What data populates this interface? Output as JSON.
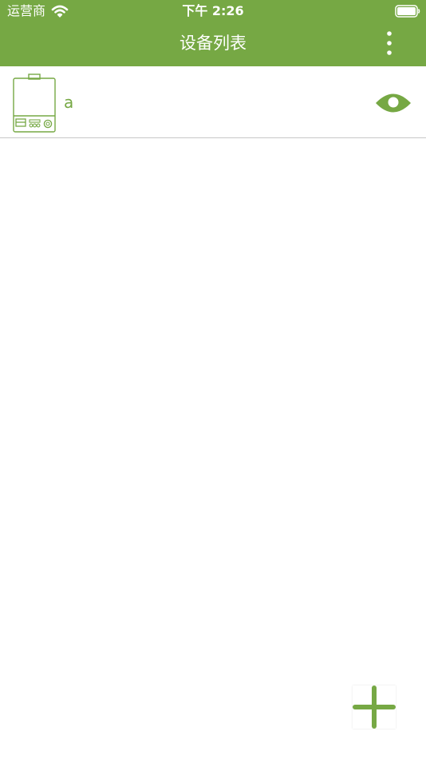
{
  "status_bar": {
    "carrier": "运营商",
    "time": "下午 2:26",
    "wifi_icon": "wifi-icon",
    "battery_icon": "battery-icon"
  },
  "nav_bar": {
    "title": "设备列表",
    "more_icon": "more-vertical-icon",
    "background_color": "#76a844"
  },
  "devices": [
    {
      "name": "a",
      "icon": "water-heater-icon",
      "action_icon": "eye-icon"
    }
  ],
  "add_button": {
    "icon": "plus-icon"
  },
  "colors": {
    "accent": "#76a844",
    "divider": "#c8c8c8",
    "background": "#ffffff"
  }
}
